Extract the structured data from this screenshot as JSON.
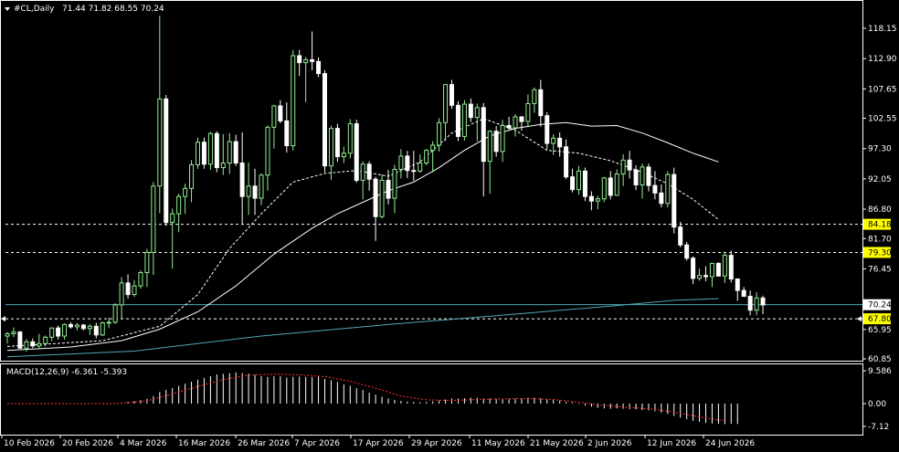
{
  "header": {
    "symbol": "#CL,Daily",
    "ohlc": "71.44 71.82 68.55 70.24",
    "macd_label": "MACD(12,26,9) -6.361 -5.393"
  },
  "colors": {
    "background": "#000000",
    "grid_frame": "#ffffff",
    "bull_candle": "#90ee90",
    "bear_candle": "#ffffff",
    "ma_fast": "#ffffff",
    "ma_long": "#4fa8b8",
    "current_price_line": "#4fa8b8",
    "level_line": "#ffffff",
    "level_label_bg": "#ffff00",
    "macd_hist": "#ffffff",
    "macd_signal": "#ff3333"
  },
  "chart_data": [
    {
      "type": "candlestick",
      "title": "#CL,Daily",
      "ylim": [
        60.85,
        121.0
      ],
      "y_tick_labels": [
        "118.15",
        "112.90",
        "107.65",
        "102.55",
        "97.30",
        "92.05",
        "86.80",
        "81.70",
        "76.45",
        "65.95",
        "60.85"
      ],
      "x_tick_labels": [
        "10 Feb 2026",
        "20 Feb 2026",
        "4 Mar 2026",
        "16 Mar 2026",
        "26 Mar 2026",
        "7 Apr 2026",
        "17 Apr 2026",
        "29 Apr 2026",
        "11 May 2026",
        "21 May 2026",
        "2 Jun 2026",
        "12 Jun 2026",
        "24 Jun 2026"
      ],
      "current_price": 70.24,
      "current_price_label": "70.24",
      "horizontal_levels": [
        {
          "value": 84.18,
          "label": "84.18"
        },
        {
          "value": 79.3,
          "label": "79.30"
        },
        {
          "value": 67.8,
          "label": "67.80"
        }
      ],
      "candles": [
        [
          64.8,
          65.5,
          63.5,
          65.2
        ],
        [
          65.2,
          66.3,
          64.6,
          65.5
        ],
        [
          65.5,
          65.7,
          62.6,
          62.7
        ],
        [
          62.7,
          64.3,
          62.1,
          63.8
        ],
        [
          63.8,
          64.4,
          62.7,
          63.1
        ],
        [
          63.1,
          65.2,
          62.7,
          63.5
        ],
        [
          63.5,
          64.9,
          63.0,
          64.6
        ],
        [
          64.6,
          66.3,
          63.9,
          66.2
        ],
        [
          66.2,
          66.6,
          64.2,
          64.8
        ],
        [
          64.8,
          67.0,
          64.2,
          66.8
        ],
        [
          66.8,
          67.2,
          66.1,
          66.4
        ],
        [
          66.4,
          67.1,
          65.8,
          66.7
        ],
        [
          66.7,
          66.9,
          65.8,
          66.1
        ],
        [
          66.1,
          66.9,
          65.0,
          66.5
        ],
        [
          66.5,
          67.1,
          64.4,
          65.0
        ],
        [
          65.0,
          67.3,
          64.8,
          67.1
        ],
        [
          67.1,
          68.0,
          66.2,
          67.2
        ],
        [
          67.2,
          70.5,
          66.9,
          70.2
        ],
        [
          70.2,
          75.0,
          67.8,
          74.0
        ],
        [
          74.0,
          75.5,
          71.3,
          72.0
        ],
        [
          72.0,
          74.5,
          71.6,
          73.5
        ],
        [
          73.5,
          76.2,
          73.0,
          75.8
        ],
        [
          75.8,
          79.9,
          73.3,
          79.3
        ],
        [
          79.3,
          91.5,
          75.4,
          90.8
        ],
        [
          90.8,
          120.3,
          86.1,
          105.9
        ],
        [
          105.9,
          106.6,
          83.9,
          84.5
        ],
        [
          84.5,
          86.9,
          76.5,
          86.0
        ],
        [
          86.0,
          89.5,
          82.8,
          89.0
        ],
        [
          89.0,
          91.2,
          86.0,
          90.4
        ],
        [
          90.4,
          95.3,
          88.0,
          94.5
        ],
        [
          94.5,
          99.2,
          93.8,
          98.4
        ],
        [
          98.4,
          99.2,
          93.8,
          94.6
        ],
        [
          94.6,
          100.2,
          93.6,
          99.9
        ],
        [
          99.9,
          100.3,
          93.2,
          94.0
        ],
        [
          94.0,
          99.8,
          92.7,
          94.8
        ],
        [
          94.8,
          100.0,
          92.9,
          98.5
        ],
        [
          98.5,
          99.7,
          94.3,
          94.8
        ],
        [
          94.8,
          100.1,
          84.3,
          89.0
        ],
        [
          89.0,
          94.9,
          85.8,
          90.8
        ],
        [
          90.8,
          93.8,
          85.8,
          88.7
        ],
        [
          88.7,
          93.0,
          87.5,
          92.7
        ],
        [
          92.7,
          101.3,
          90.0,
          101.0
        ],
        [
          101.0,
          104.9,
          97.3,
          104.7
        ],
        [
          104.7,
          105.7,
          101.7,
          102.1
        ],
        [
          102.1,
          105.3,
          96.6,
          97.8
        ],
        [
          97.8,
          114.4,
          97.0,
          113.4
        ],
        [
          113.4,
          114.4,
          109.9,
          112.2
        ],
        [
          112.2,
          113.2,
          105.3,
          112.7
        ],
        [
          112.7,
          117.6,
          110.9,
          112.4
        ],
        [
          112.4,
          113.1,
          109.7,
          110.3
        ],
        [
          110.3,
          110.9,
          93.2,
          94.3
        ],
        [
          94.3,
          101.3,
          91.9,
          100.8
        ],
        [
          100.8,
          101.6,
          95.0,
          95.9
        ],
        [
          95.9,
          97.6,
          94.8,
          96.5
        ],
        [
          96.5,
          102.4,
          95.6,
          101.6
        ],
        [
          101.6,
          102.3,
          91.4,
          91.8
        ],
        [
          91.8,
          95.1,
          88.5,
          94.6
        ],
        [
          94.6,
          95.1,
          90.0,
          92.0
        ],
        [
          92.0,
          92.4,
          81.3,
          85.5
        ],
        [
          85.5,
          92.8,
          85.2,
          91.8
        ],
        [
          91.8,
          93.6,
          87.6,
          88.7
        ],
        [
          88.7,
          94.5,
          86.1,
          93.7
        ],
        [
          93.7,
          97.2,
          92.1,
          96.0
        ],
        [
          96.0,
          96.9,
          92.2,
          93.5
        ],
        [
          93.5,
          96.9,
          91.7,
          93.4
        ],
        [
          93.4,
          96.3,
          93.1,
          94.8
        ],
        [
          94.8,
          97.2,
          94.4,
          97.0
        ],
        [
          97.0,
          98.6,
          93.2,
          97.9
        ],
        [
          97.9,
          102.6,
          96.8,
          101.8
        ],
        [
          101.8,
          108.5,
          98.6,
          108.4
        ],
        [
          108.4,
          109.2,
          104.2,
          104.8
        ],
        [
          104.8,
          105.5,
          98.6,
          99.4
        ],
        [
          99.4,
          105.7,
          98.7,
          105.0
        ],
        [
          105.0,
          106.0,
          101.9,
          102.7
        ],
        [
          102.7,
          105.1,
          98.6,
          104.4
        ],
        [
          104.4,
          105.2,
          89.0,
          95.1
        ],
        [
          95.1,
          100.5,
          89.5,
          100.3
        ],
        [
          100.3,
          101.2,
          95.9,
          96.8
        ],
        [
          96.8,
          102.3,
          95.0,
          101.3
        ],
        [
          101.3,
          102.8,
          100.4,
          100.9
        ],
        [
          100.9,
          103.3,
          99.4,
          102.8
        ],
        [
          102.8,
          102.9,
          100.4,
          102.0
        ],
        [
          102.0,
          106.7,
          101.0,
          105.1
        ],
        [
          105.1,
          107.9,
          103.5,
          107.5
        ],
        [
          107.5,
          109.2,
          101.1,
          103.0
        ],
        [
          103.0,
          103.6,
          97.2,
          98.2
        ],
        [
          98.2,
          99.8,
          96.2,
          99.1
        ],
        [
          99.1,
          100.1,
          95.9,
          97.6
        ],
        [
          97.6,
          98.9,
          92.0,
          92.4
        ],
        [
          92.4,
          93.8,
          89.7,
          90.2
        ],
        [
          90.2,
          94.3,
          89.3,
          93.4
        ],
        [
          93.4,
          94.0,
          88.2,
          89.0
        ],
        [
          89.0,
          89.9,
          86.6,
          88.2
        ],
        [
          88.2,
          89.1,
          86.8,
          88.6
        ],
        [
          88.6,
          92.4,
          88.0,
          92.2
        ],
        [
          92.2,
          93.4,
          88.5,
          89.2
        ],
        [
          89.2,
          93.7,
          89.1,
          92.9
        ],
        [
          92.9,
          96.3,
          90.8,
          95.3
        ],
        [
          95.3,
          96.9,
          92.1,
          93.6
        ],
        [
          93.6,
          94.4,
          90.1,
          91.0
        ],
        [
          91.0,
          94.7,
          88.6,
          94.1
        ],
        [
          94.1,
          94.7,
          89.9,
          90.9
        ],
        [
          90.9,
          93.4,
          88.5,
          89.6
        ],
        [
          89.6,
          91.1,
          87.1,
          87.8
        ],
        [
          87.8,
          93.4,
          87.1,
          92.8
        ],
        [
          92.8,
          94.0,
          82.6,
          83.7
        ],
        [
          83.7,
          84.6,
          80.2,
          80.6
        ],
        [
          80.6,
          81.1,
          77.9,
          78.3
        ],
        [
          78.3,
          78.6,
          73.8,
          74.8
        ],
        [
          74.8,
          76.5,
          74.4,
          75.3
        ],
        [
          75.3,
          76.9,
          74.3,
          75.1
        ],
        [
          75.1,
          77.4,
          73.3,
          77.4
        ],
        [
          77.4,
          77.6,
          75.1,
          75.2
        ],
        [
          75.2,
          79.4,
          74.0,
          78.8
        ],
        [
          78.8,
          79.6,
          74.1,
          74.7
        ],
        [
          74.7,
          74.8,
          70.9,
          72.7
        ],
        [
          72.7,
          73.3,
          71.6,
          71.7
        ],
        [
          71.7,
          72.7,
          68.4,
          69.3
        ],
        [
          69.3,
          72.4,
          68.4,
          71.4
        ],
        [
          71.4,
          71.8,
          68.6,
          70.2
        ]
      ],
      "ma_fast": [
        [
          0,
          63.0
        ],
        [
          15,
          64.0
        ],
        [
          24,
          66.5
        ],
        [
          30,
          72.0
        ],
        [
          35,
          80.0
        ],
        [
          40,
          86.0
        ],
        [
          45,
          91.5
        ],
        [
          50,
          93.0
        ],
        [
          55,
          93.5
        ],
        [
          60,
          92.5
        ],
        [
          65,
          95.0
        ],
        [
          70,
          100.0
        ],
        [
          75,
          102.5
        ],
        [
          80,
          100.5
        ],
        [
          85,
          97.0
        ],
        [
          90,
          96.5
        ],
        [
          95,
          95.2
        ],
        [
          100,
          93.2
        ],
        [
          104,
          91.2
        ],
        [
          108,
          88.5
        ],
        [
          112,
          85.0
        ]
      ],
      "ma_mid": [
        [
          0,
          62.3
        ],
        [
          10,
          62.9
        ],
        [
          18,
          64.0
        ],
        [
          24,
          66.0
        ],
        [
          30,
          69.0
        ],
        [
          36,
          73.5
        ],
        [
          42,
          79.0
        ],
        [
          48,
          83.5
        ],
        [
          52,
          86.0
        ],
        [
          56,
          88.0
        ],
        [
          60,
          90.0
        ],
        [
          64,
          91.5
        ],
        [
          68,
          94.0
        ],
        [
          72,
          97.0
        ],
        [
          76,
          99.5
        ],
        [
          80,
          100.8
        ],
        [
          84,
          101.5
        ],
        [
          88,
          101.8
        ],
        [
          92,
          101.2
        ],
        [
          96,
          101.3
        ],
        [
          100,
          100.0
        ],
        [
          104,
          98.3
        ],
        [
          108,
          96.5
        ],
        [
          112,
          95.0
        ]
      ],
      "ma_long": [
        [
          0,
          61.2
        ],
        [
          20,
          62.2
        ],
        [
          40,
          64.8
        ],
        [
          60,
          66.8
        ],
        [
          80,
          68.6
        ],
        [
          95,
          70.0
        ],
        [
          105,
          71.0
        ],
        [
          112,
          71.3
        ]
      ]
    },
    {
      "type": "bar",
      "title": "MACD(12,26,9)",
      "macd_value": -6.361,
      "signal_value": -5.393,
      "ylim": [
        -7.12,
        9.586
      ],
      "y_tick_labels": [
        "9.586",
        "0.00",
        "-7.12"
      ],
      "histogram": [
        0.0,
        0.0,
        0.0,
        0.0,
        0.0,
        0.0,
        0.0,
        0.0,
        0.0,
        0.0,
        0.0,
        0.0,
        0.0,
        0.0,
        0.0,
        0.0,
        0.0,
        0.1,
        0.3,
        0.5,
        0.7,
        1.0,
        1.4,
        2.2,
        3.4,
        4.0,
        4.5,
        5.2,
        5.8,
        6.4,
        7.0,
        7.5,
        8.0,
        8.5,
        8.7,
        8.9,
        9.1,
        8.9,
        8.7,
        8.4,
        8.0,
        7.8,
        8.0,
        8.0,
        7.6,
        7.8,
        7.9,
        7.8,
        7.8,
        7.9,
        7.2,
        6.8,
        6.3,
        5.6,
        5.2,
        4.5,
        4.0,
        3.2,
        2.6,
        2.0,
        1.5,
        1.1,
        0.8,
        0.6,
        0.5,
        0.4,
        0.5,
        0.6,
        0.9,
        1.2,
        1.5,
        1.5,
        1.6,
        1.7,
        1.7,
        1.5,
        1.5,
        1.3,
        1.2,
        1.3,
        1.4,
        1.5,
        1.8,
        1.7,
        1.5,
        1.3,
        1.1,
        0.9,
        0.5,
        0.3,
        -0.2,
        -0.6,
        -1.0,
        -1.3,
        -1.5,
        -1.6,
        -1.5,
        -1.6,
        -1.7,
        -1.8,
        -2.0,
        -2.1,
        -2.4,
        -2.8,
        -3.2,
        -3.8,
        -4.4,
        -4.9,
        -5.4,
        -5.7,
        -6.0,
        -6.2,
        -6.3,
        -6.4,
        -6.3,
        -6.36
      ],
      "signal": [
        [
          0,
          0.0
        ],
        [
          17,
          0.0
        ],
        [
          22,
          0.8
        ],
        [
          26,
          2.8
        ],
        [
          30,
          5.0
        ],
        [
          34,
          7.0
        ],
        [
          38,
          8.3
        ],
        [
          42,
          8.6
        ],
        [
          46,
          8.4
        ],
        [
          50,
          7.9
        ],
        [
          54,
          6.5
        ],
        [
          58,
          4.5
        ],
        [
          62,
          2.2
        ],
        [
          66,
          1.1
        ],
        [
          70,
          0.9
        ],
        [
          74,
          1.2
        ],
        [
          78,
          1.4
        ],
        [
          82,
          1.5
        ],
        [
          86,
          1.2
        ],
        [
          90,
          0.4
        ],
        [
          94,
          -0.6
        ],
        [
          98,
          -1.2
        ],
        [
          102,
          -1.8
        ],
        [
          106,
          -3.0
        ],
        [
          110,
          -4.5
        ],
        [
          113,
          -5.393
        ]
      ]
    }
  ]
}
